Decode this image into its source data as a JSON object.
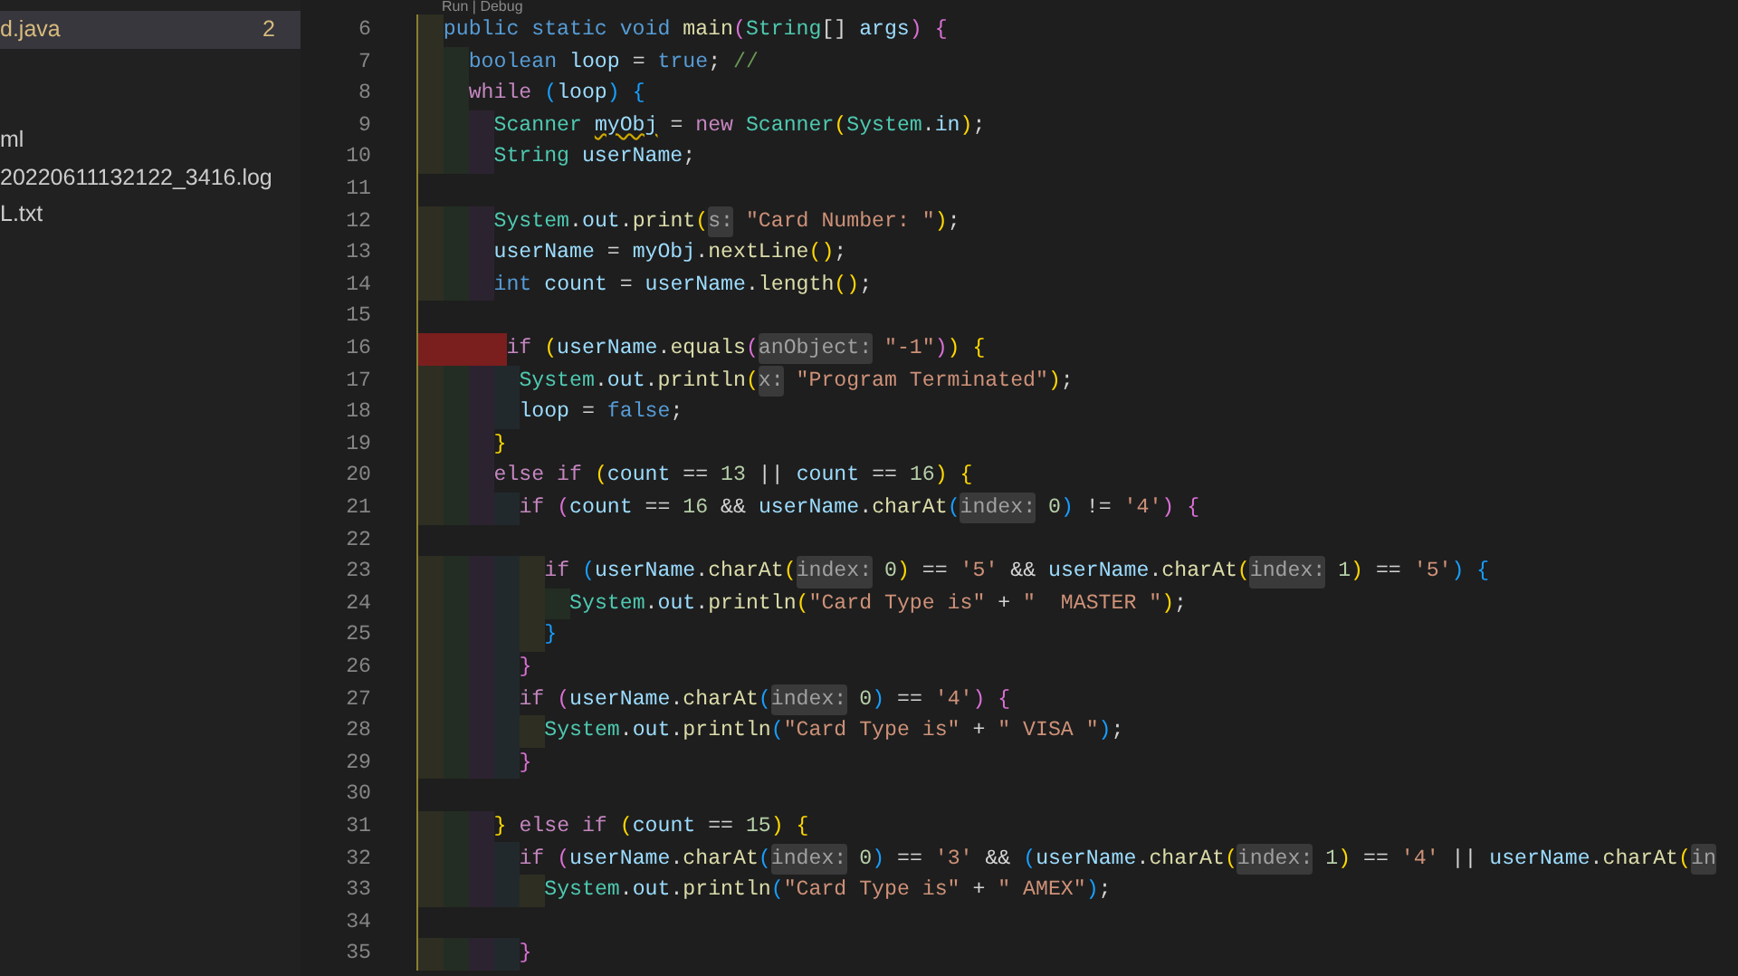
{
  "sidebar": {
    "items": [
      {
        "label": "d.java",
        "badge": "2",
        "selected": true,
        "modified": true
      },
      {
        "label": "ml",
        "selected": false,
        "modified": false
      },
      {
        "label": "20220611132122_3416.log",
        "selected": false,
        "modified": false
      },
      {
        "label": "L.txt",
        "selected": false,
        "modified": false
      }
    ]
  },
  "editor": {
    "codelens": "Run | Debug",
    "lines": [
      {
        "number": "6",
        "code": [
          {
            "kind": "keyword",
            "text": "  public static void "
          },
          {
            "kind": "function",
            "text": "main"
          },
          {
            "kind": "bracket2",
            "text": "("
          },
          {
            "kind": "type",
            "text": "String"
          },
          {
            "kind": "plain",
            "text": "[] "
          },
          {
            "kind": "variable",
            "text": "args"
          },
          {
            "kind": "bracket2",
            "text": ") {"
          }
        ]
      },
      {
        "number": "7",
        "code": [
          {
            "kind": "keyword",
            "text": "    boolean "
          },
          {
            "kind": "variable",
            "text": "loop"
          },
          {
            "kind": "plain",
            "text": " = "
          },
          {
            "kind": "keyword",
            "text": "true"
          },
          {
            "kind": "plain",
            "text": "; "
          },
          {
            "kind": "comment",
            "text": "//"
          }
        ]
      },
      {
        "number": "8",
        "code": [
          {
            "kind": "control",
            "text": "    while "
          },
          {
            "kind": "bracket3",
            "text": "("
          },
          {
            "kind": "variable",
            "text": "loop"
          },
          {
            "kind": "bracket3",
            "text": ") {"
          }
        ]
      },
      {
        "number": "9",
        "code": [
          {
            "kind": "type",
            "text": "      Scanner "
          },
          {
            "kind": "warning",
            "text": "myObj"
          },
          {
            "kind": "plain",
            "text": " = "
          },
          {
            "kind": "control",
            "text": "new "
          },
          {
            "kind": "type",
            "text": "Scanner"
          },
          {
            "kind": "bracket1",
            "text": "("
          },
          {
            "kind": "type",
            "text": "System"
          },
          {
            "kind": "plain",
            "text": "."
          },
          {
            "kind": "variable",
            "text": "in"
          },
          {
            "kind": "bracket1",
            "text": ")"
          },
          {
            "kind": "plain",
            "text": ";"
          }
        ]
      },
      {
        "number": "10",
        "code": [
          {
            "kind": "type",
            "text": "      String "
          },
          {
            "kind": "variable",
            "text": "userName"
          },
          {
            "kind": "plain",
            "text": ";"
          }
        ]
      },
      {
        "number": "11"
      },
      {
        "number": "12",
        "code": [
          {
            "kind": "type",
            "text": "      System"
          },
          {
            "kind": "plain",
            "text": "."
          },
          {
            "kind": "variable",
            "text": "out"
          },
          {
            "kind": "plain",
            "text": "."
          },
          {
            "kind": "function",
            "text": "print"
          },
          {
            "kind": "bracket1",
            "text": "("
          },
          {
            "kind": "hint",
            "text": "s:"
          },
          {
            "kind": "string",
            "text": " \"Card Number: \""
          },
          {
            "kind": "bracket1",
            "text": ")"
          },
          {
            "kind": "plain",
            "text": ";"
          }
        ]
      },
      {
        "number": "13",
        "code": [
          {
            "kind": "variable",
            "text": "      userName"
          },
          {
            "kind": "plain",
            "text": " = "
          },
          {
            "kind": "variable",
            "text": "myObj"
          },
          {
            "kind": "plain",
            "text": "."
          },
          {
            "kind": "function",
            "text": "nextLine"
          },
          {
            "kind": "bracket1",
            "text": "()"
          },
          {
            "kind": "plain",
            "text": ";"
          }
        ]
      },
      {
        "number": "14",
        "code": [
          {
            "kind": "keyword",
            "text": "      int "
          },
          {
            "kind": "variable",
            "text": "count"
          },
          {
            "kind": "plain",
            "text": " = "
          },
          {
            "kind": "variable",
            "text": "userName"
          },
          {
            "kind": "plain",
            "text": "."
          },
          {
            "kind": "function",
            "text": "length"
          },
          {
            "kind": "bracket1",
            "text": "()"
          },
          {
            "kind": "plain",
            "text": ";"
          }
        ]
      },
      {
        "number": "15"
      },
      {
        "number": "16",
        "indent_error": true,
        "code": [
          {
            "kind": "control",
            "text": "       if "
          },
          {
            "kind": "bracket1",
            "text": "("
          },
          {
            "kind": "variable",
            "text": "userName"
          },
          {
            "kind": "plain",
            "text": "."
          },
          {
            "kind": "function",
            "text": "equals"
          },
          {
            "kind": "bracket2",
            "text": "("
          },
          {
            "kind": "hint",
            "text": "anObject:"
          },
          {
            "kind": "string",
            "text": " \"-1\""
          },
          {
            "kind": "bracket2",
            "text": ")"
          },
          {
            "kind": "bracket1",
            "text": ") {"
          }
        ]
      },
      {
        "number": "17",
        "code": [
          {
            "kind": "type",
            "text": "        System"
          },
          {
            "kind": "plain",
            "text": "."
          },
          {
            "kind": "variable",
            "text": "out"
          },
          {
            "kind": "plain",
            "text": "."
          },
          {
            "kind": "function",
            "text": "println"
          },
          {
            "kind": "bracket1",
            "text": "("
          },
          {
            "kind": "hint",
            "text": "x:"
          },
          {
            "kind": "string",
            "text": " \"Program Terminated\""
          },
          {
            "kind": "bracket1",
            "text": ")"
          },
          {
            "kind": "plain",
            "text": ";"
          }
        ]
      },
      {
        "number": "18",
        "code": [
          {
            "kind": "variable",
            "text": "        loop"
          },
          {
            "kind": "plain",
            "text": " = "
          },
          {
            "kind": "keyword",
            "text": "false"
          },
          {
            "kind": "plain",
            "text": ";"
          }
        ]
      },
      {
        "number": "19",
        "code": [
          {
            "kind": "bracket1",
            "text": "      }"
          }
        ]
      },
      {
        "number": "20",
        "code": [
          {
            "kind": "control",
            "text": "      else if "
          },
          {
            "kind": "bracket1",
            "text": "("
          },
          {
            "kind": "variable",
            "text": "count"
          },
          {
            "kind": "plain",
            "text": " == "
          },
          {
            "kind": "number",
            "text": "13"
          },
          {
            "kind": "plain",
            "text": " || "
          },
          {
            "kind": "variable",
            "text": "count"
          },
          {
            "kind": "plain",
            "text": " == "
          },
          {
            "kind": "number",
            "text": "16"
          },
          {
            "kind": "bracket1",
            "text": ") {"
          }
        ]
      },
      {
        "number": "21",
        "code": [
          {
            "kind": "control",
            "text": "        if "
          },
          {
            "kind": "bracket2",
            "text": "("
          },
          {
            "kind": "variable",
            "text": "count"
          },
          {
            "kind": "plain",
            "text": " == "
          },
          {
            "kind": "number",
            "text": "16"
          },
          {
            "kind": "plain",
            "text": " && "
          },
          {
            "kind": "variable",
            "text": "userName"
          },
          {
            "kind": "plain",
            "text": "."
          },
          {
            "kind": "function",
            "text": "charAt"
          },
          {
            "kind": "bracket3",
            "text": "("
          },
          {
            "kind": "hint",
            "text": "index:"
          },
          {
            "kind": "number",
            "text": " 0"
          },
          {
            "kind": "bracket3",
            "text": ")"
          },
          {
            "kind": "plain",
            "text": " != "
          },
          {
            "kind": "string",
            "text": "'4'"
          },
          {
            "kind": "bracket2",
            "text": ") {"
          }
        ]
      },
      {
        "number": "22"
      },
      {
        "number": "23",
        "code": [
          {
            "kind": "control",
            "text": "          if "
          },
          {
            "kind": "bracket3",
            "text": "("
          },
          {
            "kind": "variable",
            "text": "userName"
          },
          {
            "kind": "plain",
            "text": "."
          },
          {
            "kind": "function",
            "text": "charAt"
          },
          {
            "kind": "bracket1",
            "text": "("
          },
          {
            "kind": "hint",
            "text": "index:"
          },
          {
            "kind": "number",
            "text": " 0"
          },
          {
            "kind": "bracket1",
            "text": ")"
          },
          {
            "kind": "plain",
            "text": " == "
          },
          {
            "kind": "string",
            "text": "'5'"
          },
          {
            "kind": "plain",
            "text": " && "
          },
          {
            "kind": "variable",
            "text": "userName"
          },
          {
            "kind": "plain",
            "text": "."
          },
          {
            "kind": "function",
            "text": "charAt"
          },
          {
            "kind": "bracket1",
            "text": "("
          },
          {
            "kind": "hint",
            "text": "index:"
          },
          {
            "kind": "number",
            "text": " 1"
          },
          {
            "kind": "bracket1",
            "text": ")"
          },
          {
            "kind": "plain",
            "text": " == "
          },
          {
            "kind": "string",
            "text": "'5'"
          },
          {
            "kind": "bracket3",
            "text": ") {"
          }
        ]
      },
      {
        "number": "24",
        "code": [
          {
            "kind": "type",
            "text": "            System"
          },
          {
            "kind": "plain",
            "text": "."
          },
          {
            "kind": "variable",
            "text": "out"
          },
          {
            "kind": "plain",
            "text": "."
          },
          {
            "kind": "function",
            "text": "println"
          },
          {
            "kind": "bracket1",
            "text": "("
          },
          {
            "kind": "string",
            "text": "\"Card Type is\""
          },
          {
            "kind": "plain",
            "text": " + "
          },
          {
            "kind": "string",
            "text": "\"  MASTER \""
          },
          {
            "kind": "bracket1",
            "text": ")"
          },
          {
            "kind": "plain",
            "text": ";"
          }
        ]
      },
      {
        "number": "25",
        "code": [
          {
            "kind": "bracket3",
            "text": "          }"
          }
        ]
      },
      {
        "number": "26",
        "code": [
          {
            "kind": "bracket2",
            "text": "        }"
          }
        ]
      },
      {
        "number": "27",
        "code": [
          {
            "kind": "control",
            "text": "        if "
          },
          {
            "kind": "bracket2",
            "text": "("
          },
          {
            "kind": "variable",
            "text": "userName"
          },
          {
            "kind": "plain",
            "text": "."
          },
          {
            "kind": "function",
            "text": "charAt"
          },
          {
            "kind": "bracket3",
            "text": "("
          },
          {
            "kind": "hint",
            "text": "index:"
          },
          {
            "kind": "number",
            "text": " 0"
          },
          {
            "kind": "bracket3",
            "text": ")"
          },
          {
            "kind": "plain",
            "text": " == "
          },
          {
            "kind": "string",
            "text": "'4'"
          },
          {
            "kind": "bracket2",
            "text": ") {"
          }
        ]
      },
      {
        "number": "28",
        "code": [
          {
            "kind": "type",
            "text": "          System"
          },
          {
            "kind": "plain",
            "text": "."
          },
          {
            "kind": "variable",
            "text": "out"
          },
          {
            "kind": "plain",
            "text": "."
          },
          {
            "kind": "function",
            "text": "println"
          },
          {
            "kind": "bracket3",
            "text": "("
          },
          {
            "kind": "string",
            "text": "\"Card Type is\""
          },
          {
            "kind": "plain",
            "text": " + "
          },
          {
            "kind": "string",
            "text": "\" VISA \""
          },
          {
            "kind": "bracket3",
            "text": ")"
          },
          {
            "kind": "plain",
            "text": ";"
          }
        ]
      },
      {
        "number": "29",
        "code": [
          {
            "kind": "bracket2",
            "text": "        }"
          }
        ]
      },
      {
        "number": "30"
      },
      {
        "number": "31",
        "code": [
          {
            "kind": "bracket1",
            "text": "      }"
          },
          {
            "kind": "control",
            "text": " else if "
          },
          {
            "kind": "bracket1",
            "text": "("
          },
          {
            "kind": "variable",
            "text": "count"
          },
          {
            "kind": "plain",
            "text": " == "
          },
          {
            "kind": "number",
            "text": "15"
          },
          {
            "kind": "bracket1",
            "text": ") {"
          }
        ]
      },
      {
        "number": "32",
        "code": [
          {
            "kind": "control",
            "text": "        if "
          },
          {
            "kind": "bracket2",
            "text": "("
          },
          {
            "kind": "variable",
            "text": "userName"
          },
          {
            "kind": "plain",
            "text": "."
          },
          {
            "kind": "function",
            "text": "charAt"
          },
          {
            "kind": "bracket3",
            "text": "("
          },
          {
            "kind": "hint",
            "text": "index:"
          },
          {
            "kind": "number",
            "text": " 0"
          },
          {
            "kind": "bracket3",
            "text": ")"
          },
          {
            "kind": "plain",
            "text": " == "
          },
          {
            "kind": "string",
            "text": "'3'"
          },
          {
            "kind": "plain",
            "text": " && "
          },
          {
            "kind": "bracket3",
            "text": "("
          },
          {
            "kind": "variable",
            "text": "userName"
          },
          {
            "kind": "plain",
            "text": "."
          },
          {
            "kind": "function",
            "text": "charAt"
          },
          {
            "kind": "bracket1",
            "text": "("
          },
          {
            "kind": "hint",
            "text": "index:"
          },
          {
            "kind": "number",
            "text": " 1"
          },
          {
            "kind": "bracket1",
            "text": ")"
          },
          {
            "kind": "plain",
            "text": " == "
          },
          {
            "kind": "string",
            "text": "'4'"
          },
          {
            "kind": "plain",
            "text": " || "
          },
          {
            "kind": "variable",
            "text": "userName"
          },
          {
            "kind": "plain",
            "text": "."
          },
          {
            "kind": "function",
            "text": "charAt"
          },
          {
            "kind": "bracket1",
            "text": "("
          },
          {
            "kind": "hint",
            "text": "in"
          }
        ]
      },
      {
        "number": "33",
        "code": [
          {
            "kind": "type",
            "text": "          System"
          },
          {
            "kind": "plain",
            "text": "."
          },
          {
            "kind": "variable",
            "text": "out"
          },
          {
            "kind": "plain",
            "text": "."
          },
          {
            "kind": "function",
            "text": "println"
          },
          {
            "kind": "bracket3",
            "text": "("
          },
          {
            "kind": "string",
            "text": "\"Card Type is\""
          },
          {
            "kind": "plain",
            "text": " + "
          },
          {
            "kind": "string",
            "text": "\" AMEX\""
          },
          {
            "kind": "bracket3",
            "text": ")"
          },
          {
            "kind": "plain",
            "text": ";"
          }
        ]
      },
      {
        "number": "34"
      },
      {
        "number": "35",
        "code": [
          {
            "kind": "bracket2",
            "text": "        }"
          }
        ]
      }
    ]
  }
}
